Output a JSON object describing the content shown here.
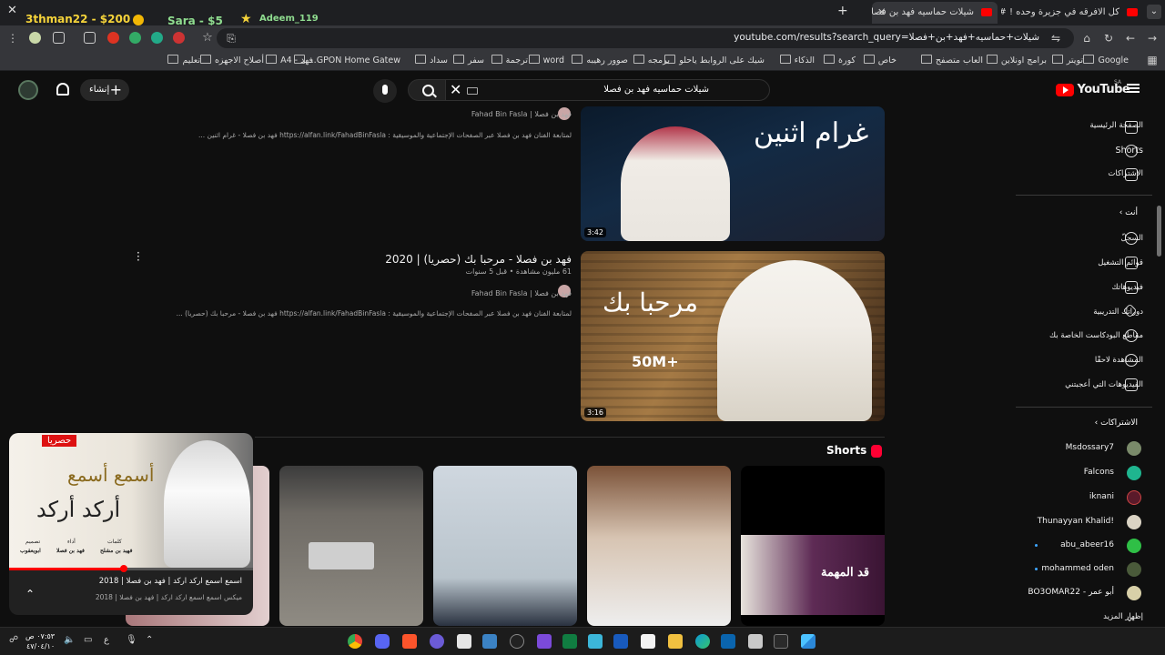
{
  "overlay": {
    "stat1": "3thman22 - $200",
    "stat2": "Sara - $5",
    "stat3": "Adeem_119"
  },
  "tabs": [
    {
      "label": "كل الافرقه في جزيرة وحده ! #1 -",
      "active": false
    },
    {
      "label": "شيلات حماسيه فهد بن فصلا - ⁦Yo",
      "active": true
    }
  ],
  "address": {
    "url": "youtube.com/results?search_query=شيلات+حماسيه+فهد+بن+فصلا"
  },
  "bookmarks": [
    "Google",
    "تويتر",
    "برامج اونلاين",
    "العاب متصفح",
    "خاص",
    "كورة",
    "الذكاء",
    "شيك على الروابط ياحلو",
    "برمجه",
    "صوور رهيبه",
    "word",
    "ترجمة",
    "سفر",
    "سداد",
    "GPON Home Gatew...",
    "فهد - A4",
    "أصلاح الاجهزه",
    "تعليم"
  ],
  "header": {
    "logo": "YouTube",
    "region": "SA",
    "search_query": "شيلات حماسيه فهد بن فصلا",
    "create_label": "إنشاء"
  },
  "sidebar": {
    "main": [
      "الصفحة الرئيسية",
      "Shorts",
      "الاشتراكات"
    ],
    "you_header": "أنت",
    "you_items": [
      "السجلّ",
      "قوائم التشغيل",
      "فيديوهاتك",
      "دوراتك التدريبية",
      "مقاطع البودكاست الخاصة بك",
      "المشاهدة لاحقًا",
      "الفيديوهات التي أعجبتني"
    ],
    "subs_header": "الاشتراكات",
    "subscriptions": [
      "Msdossary7",
      "Falcons",
      "iknani",
      "Thunayyan Khalid!",
      "abu_abeer16",
      "mohammed oden",
      "BO3OMAR22 - أبو عمر"
    ],
    "show_more": "إظهار المزيد"
  },
  "results": [
    {
      "title": "",
      "channel": "فهد بن فصلا | Fahad Bin Fasla",
      "desc": "لمتابعة الفنان فهد بن فصلا عبر الصفحات الإجتماعية والموسيقية : https://alfan.link/FahadBinFasla فهد بن فصلا - غرام اثنين ...",
      "thumb_text": "غرام اثنين",
      "duration": "3:42"
    },
    {
      "title": "فهد بن فصلا - مرحبا بك (حصريا) | 2020",
      "stats": "61 مليون مشاهدة • قبل 5 سنوات",
      "channel": "فهد بن فصلا | Fahad Bin Fasla",
      "desc": "لمتابعة الفنان فهد بن فصلا عبر الصفحات الإجتماعية والموسيقية : https://alfan.link/FahadBinFasla فهد بن فصلا - مرحبا بك (حصريا) ...",
      "thumb_text": "مرحبا بك",
      "views_badge": "50M+",
      "duration": "3:16"
    }
  ],
  "shorts": {
    "title": "Shorts",
    "last_card_text": "قد المهمة"
  },
  "miniplayer": {
    "badge": "حصريا",
    "art_line1": "أسمع أسمع",
    "art_line2": "أركد أركد",
    "credits": [
      "كلمات",
      "أداء",
      "تصميم",
      "فهيد بن مشلح",
      "فهد بن فصلا",
      "ابويعقوب"
    ],
    "title": "اسمع اسمع اركد اركد | فهد بن فصلا | 2018",
    "subtitle": "ميكس اسمع اسمع اركد اركد | فهد بن فصلا | 2018",
    "progress": 0.47
  },
  "taskbar": {
    "time": "٠٧:٥٣ ص",
    "date": "٤٧/٠٤/١٠",
    "lang": "ع"
  }
}
